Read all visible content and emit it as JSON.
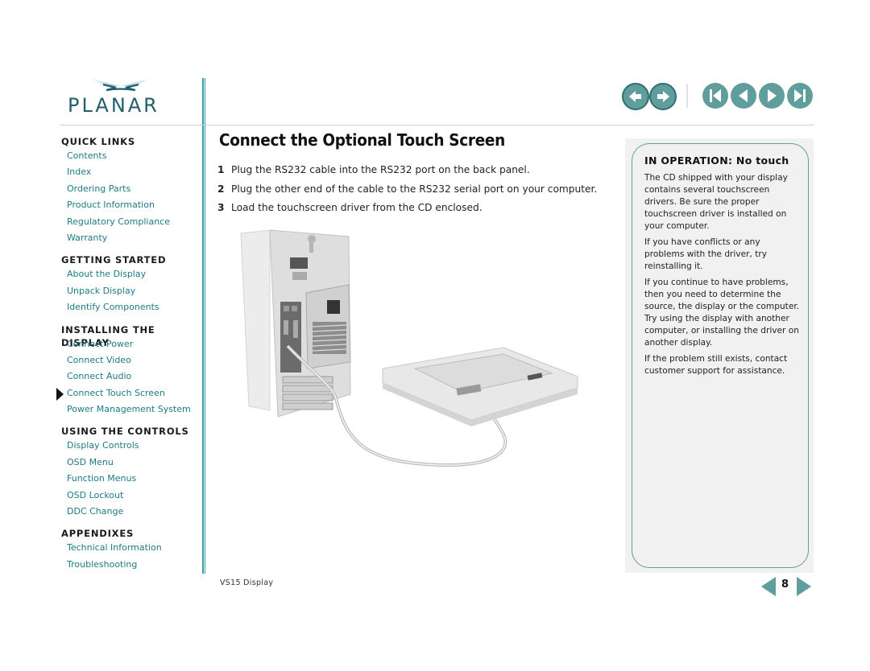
{
  "brand": {
    "name": "PLANAR",
    "accent_color": "#5f9e9c",
    "link_color": "#1d7a88"
  },
  "nav": {
    "history_buttons": [
      {
        "name": "back",
        "icon": "back-arrow-icon"
      },
      {
        "name": "forward",
        "icon": "forward-arrow-icon"
      }
    ],
    "page_buttons": [
      {
        "name": "first-page",
        "icon": "first-page-icon"
      },
      {
        "name": "previous-page",
        "icon": "previous-page-icon"
      },
      {
        "name": "next-page",
        "icon": "next-page-icon"
      },
      {
        "name": "last-page",
        "icon": "last-page-icon"
      }
    ]
  },
  "sidebar": {
    "sections": [
      {
        "title": "QUICK LINKS",
        "links": [
          "Contents",
          "Index",
          "Ordering Parts",
          "Product Information",
          "Regulatory Compliance",
          "Warranty"
        ]
      },
      {
        "title": "GETTING STARTED",
        "links": [
          "About the Display",
          "Unpack Display",
          "Identify Components"
        ]
      },
      {
        "title": "INSTALLING THE DISPLAY",
        "links": [
          "Connect Power",
          "Connect Video",
          "Connect Audio",
          "Connect Touch Screen",
          "Power Management System"
        ]
      },
      {
        "title": "USING THE CONTROLS",
        "links": [
          "Display Controls",
          "OSD Menu",
          "Function Menus",
          "OSD Lockout",
          "DDC Change"
        ]
      },
      {
        "title": "APPENDIXES",
        "links": [
          "Technical Information",
          "Troubleshooting"
        ]
      }
    ],
    "current": "Connect Touch Screen"
  },
  "main": {
    "title": "Connect the Optional Touch Screen",
    "steps": [
      {
        "num": "1",
        "text": "Plug the RS232 cable into the RS232 port on the back panel."
      },
      {
        "num": "2",
        "text": "Plug the other end of the cable to the RS232 serial port on your computer."
      },
      {
        "num": "3",
        "text": "Load the touchscreen driver from the CD enclosed."
      }
    ],
    "figure_alt": "Computer tower connected by RS232 cable to the back of a flat-panel display"
  },
  "callout": {
    "title": "IN OPERATION: No touch",
    "paragraphs": [
      "The CD shipped with your display contains several touchscreen drivers. Be sure the proper touchscreen driver is installed on your computer.",
      "If you have conflicts or any problems with the driver, try reinstalling it.",
      "If you continue to have problems, then you need to determine the source, the display or the computer. Try using the display with another computer, or installing the driver on another display.",
      "If the problem still exists, contact customer support for assistance."
    ]
  },
  "footer": {
    "doc_name": "VS15 Display",
    "page_number": "8"
  }
}
